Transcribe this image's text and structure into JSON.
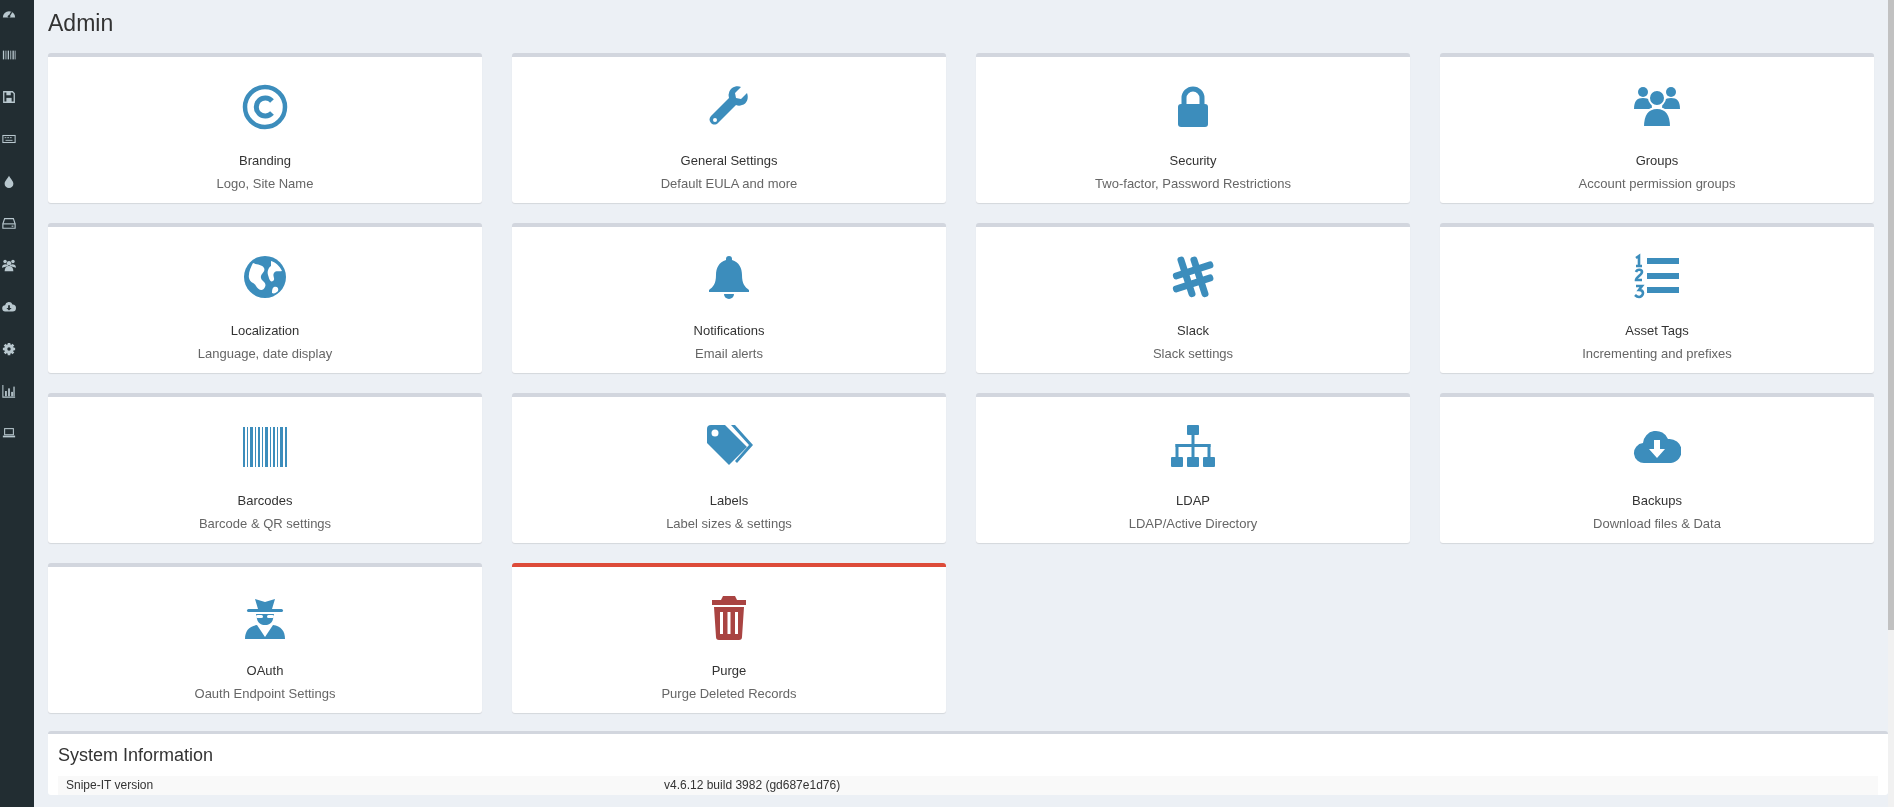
{
  "page": {
    "title": "Admin"
  },
  "cards": [
    {
      "title": "Branding",
      "subtitle": "Logo, Site Name",
      "kind": "default"
    },
    {
      "title": "General Settings",
      "subtitle": "Default EULA and more",
      "kind": "default"
    },
    {
      "title": "Security",
      "subtitle": "Two-factor, Password Restrictions",
      "kind": "default"
    },
    {
      "title": "Groups",
      "subtitle": "Account permission groups",
      "kind": "default"
    },
    {
      "title": "Localization",
      "subtitle": "Language, date display",
      "kind": "default"
    },
    {
      "title": "Notifications",
      "subtitle": "Email alerts",
      "kind": "default"
    },
    {
      "title": "Slack",
      "subtitle": "Slack settings",
      "kind": "default"
    },
    {
      "title": "Asset Tags",
      "subtitle": "Incrementing and prefixes",
      "kind": "default"
    },
    {
      "title": "Barcodes",
      "subtitle": "Barcode & QR settings",
      "kind": "default"
    },
    {
      "title": "Labels",
      "subtitle": "Label sizes & settings",
      "kind": "default"
    },
    {
      "title": "LDAP",
      "subtitle": "LDAP/Active Directory",
      "kind": "default"
    },
    {
      "title": "Backups",
      "subtitle": "Download files & Data",
      "kind": "default"
    },
    {
      "title": "OAuth",
      "subtitle": "Oauth Endpoint Settings",
      "kind": "default"
    },
    {
      "title": "Purge",
      "subtitle": "Purge Deleted Records",
      "kind": "danger"
    }
  ],
  "system_info": {
    "title": "System Information",
    "rows": [
      {
        "label": "Snipe-IT version",
        "value": "v4.6.12 build 3982 (gd687e1d76)"
      }
    ]
  }
}
